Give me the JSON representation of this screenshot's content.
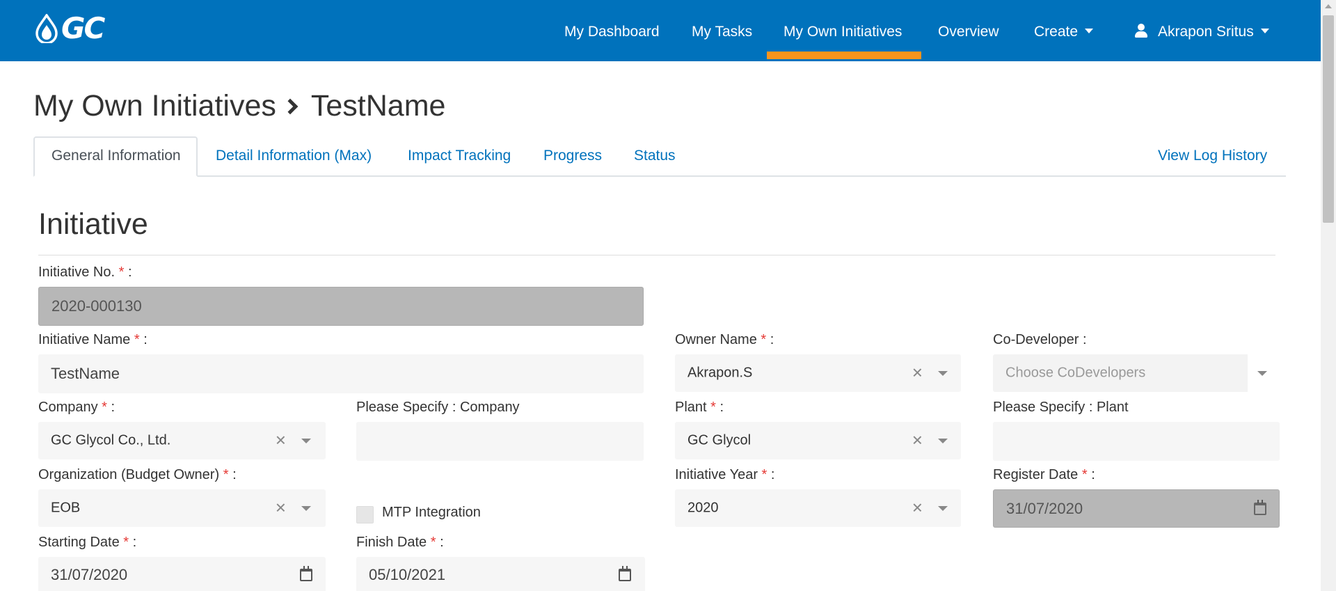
{
  "brand": {
    "logo_text": "GC"
  },
  "nav": {
    "items": [
      {
        "label": "My Dashboard"
      },
      {
        "label": "My Tasks"
      },
      {
        "label": "My Own Initiatives"
      },
      {
        "label": "Overview"
      },
      {
        "label": "Create"
      }
    ],
    "active": "My Own Initiatives",
    "user": "Akrapon Sritus",
    "accent_color": "#0072bc",
    "active_indicator_color": "#f7941d"
  },
  "breadcrumb": {
    "parent": "My Own Initiatives",
    "current": "TestName"
  },
  "tabs": {
    "items": [
      {
        "label": "General Information"
      },
      {
        "label": "Detail Information (Max)"
      },
      {
        "label": "Impact Tracking"
      },
      {
        "label": "Progress"
      },
      {
        "label": "Status"
      }
    ],
    "active": "General Information",
    "log_link": "View Log History"
  },
  "section": {
    "title": "Initiative"
  },
  "form": {
    "initiative_no": {
      "label": "Initiative No.",
      "value": "2020-000130"
    },
    "initiative_name": {
      "label": "Initiative Name",
      "value": "TestName"
    },
    "owner_name": {
      "label": "Owner Name",
      "value": "Akrapon.S"
    },
    "co_developer": {
      "label": "Co-Developer :",
      "placeholder": "Choose CoDevelopers"
    },
    "company": {
      "label": "Company",
      "value": "GC Glycol Co., Ltd."
    },
    "specify_company": {
      "label": "Please Specify : Company",
      "value": ""
    },
    "plant": {
      "label": "Plant",
      "value": "GC Glycol"
    },
    "specify_plant": {
      "label": "Please Specify : Plant",
      "value": ""
    },
    "organization": {
      "label": "Organization (Budget Owner)",
      "value": "EOB"
    },
    "mtp_integration": {
      "label": "MTP Integration",
      "checked": false
    },
    "initiative_year": {
      "label": "Initiative Year",
      "value": "2020"
    },
    "register_date": {
      "label": "Register Date",
      "value": "31/07/2020"
    },
    "starting_date": {
      "label": "Starting Date",
      "value": "31/07/2020"
    },
    "finish_date": {
      "label": "Finish Date",
      "value": "05/10/2021"
    },
    "required_mark": "*",
    "colon": ":"
  },
  "icons": [
    "logo-drop-icon",
    "user-icon",
    "chevron-right-icon",
    "clear-icon",
    "dropdown-caret-icon",
    "calendar-icon"
  ]
}
